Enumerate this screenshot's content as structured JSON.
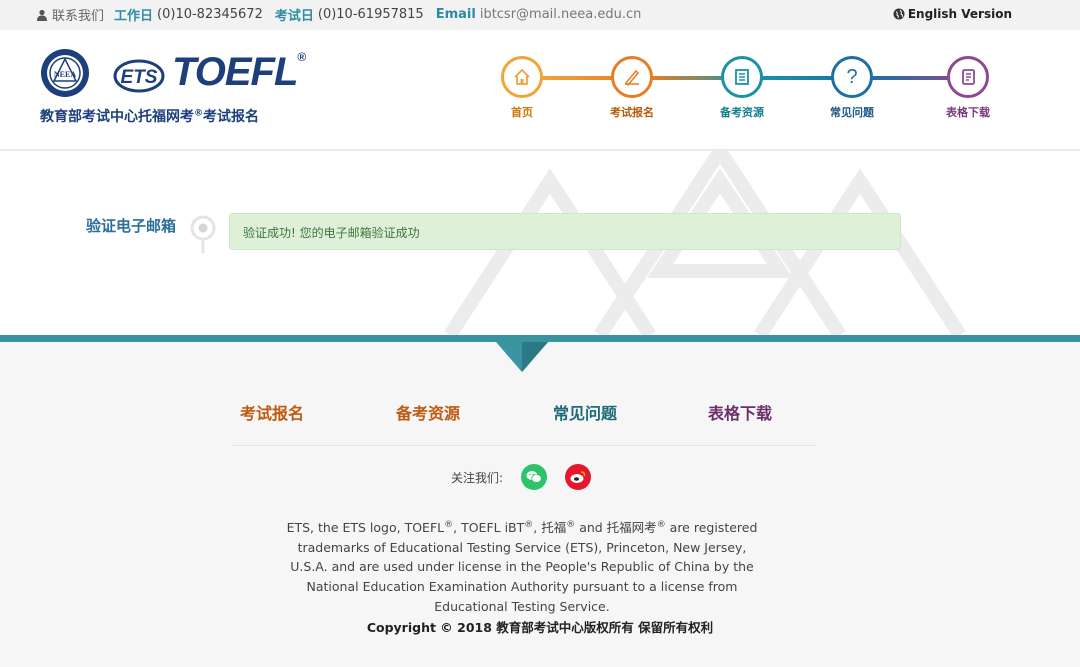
{
  "topbar": {
    "contact_label": "联系我们",
    "workday_label": "工作日",
    "workday_phone": "(0)10-82345672",
    "examday_label": "考试日",
    "examday_phone": "(0)10-61957815",
    "email_label": "Email",
    "email_value": "ibtcsr@mail.neea.edu.cn",
    "language_link": "English Version"
  },
  "header": {
    "ets_logo_text": "ETS",
    "toefl_logo_text": "TOEFL",
    "seal_text": "NEEA",
    "subtitle_pre": "教育部考试中心托福网考",
    "subtitle_reg": "®",
    "subtitle_post": "考试报名"
  },
  "nav": {
    "items": [
      {
        "label": "首页",
        "icon": "home-icon",
        "color": "#f0a43a"
      },
      {
        "label": "考试报名",
        "icon": "register-icon",
        "color": "#e67e22"
      },
      {
        "label": "备考资源",
        "icon": "resources-icon",
        "color": "#1a93a8"
      },
      {
        "label": "常见问题",
        "icon": "faq-icon",
        "color": "#1d6fa5"
      },
      {
        "label": "表格下载",
        "icon": "download-icon",
        "color": "#8e4a8f"
      }
    ]
  },
  "main": {
    "step_label": "验证电子邮箱",
    "alert_text": "验证成功! 您的电子邮箱验证成功"
  },
  "footer": {
    "links": [
      {
        "label": "考试报名",
        "color": "#c05a10"
      },
      {
        "label": "备考资源",
        "color": "#c05a10"
      },
      {
        "label": "常见问题",
        "color": "#1d6a78"
      },
      {
        "label": "表格下载",
        "color": "#6b2f6b"
      }
    ],
    "follow_label": "关注我们:",
    "social": [
      {
        "name": "wechat-icon",
        "color": "#2cc36b"
      },
      {
        "name": "weibo-icon",
        "color": "#e6162d"
      }
    ],
    "legal": {
      "t1": "ETS, the ETS logo, TOEFL",
      "t2": ", TOEFL iBT",
      "t3": ", 托福",
      "t4": " and 托福网考",
      "t5": " are registered trademarks of Educational Testing Service (ETS), Princeton, New Jersey, U.S.A. and are used under license in the People's Republic of China by the National Education Examination Authority pursuant to a license from Educational Testing Service.",
      "reg": "®"
    },
    "copyright": "Copyright © 2018 教育部考试中心版权所有 保留所有权利"
  }
}
